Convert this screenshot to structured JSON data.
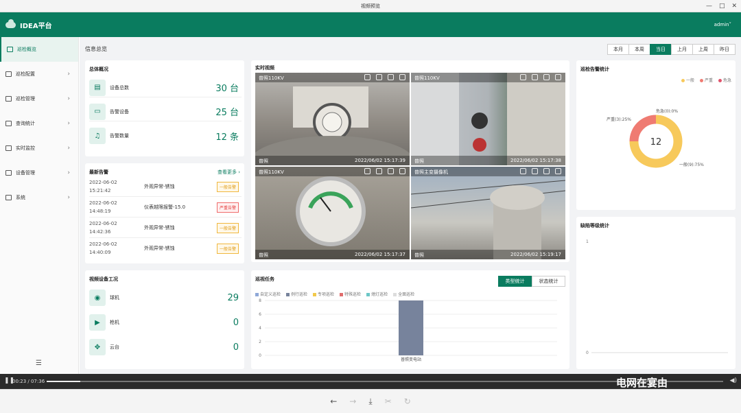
{
  "window": {
    "title": "视频预览"
  },
  "header": {
    "app_name": "IDEA平台",
    "user": "admin"
  },
  "sidebar": {
    "items": [
      {
        "label": "巡检概览",
        "active": true,
        "chevron": ""
      },
      {
        "label": "巡检配置",
        "chevron": "›"
      },
      {
        "label": "巡检管理",
        "chevron": "›"
      },
      {
        "label": "查询统计",
        "chevron": "›"
      },
      {
        "label": "实时监控",
        "chevron": "›"
      },
      {
        "label": "设备管理",
        "chevron": "›"
      },
      {
        "label": "系统",
        "chevron": "›"
      }
    ]
  },
  "main": {
    "page_title": "信息总览",
    "time_buttons": [
      "本月",
      "本周",
      "当日",
      "上月",
      "上周",
      "昨日"
    ],
    "active_time": "当日"
  },
  "overview": {
    "title": "总体概况",
    "rows": [
      {
        "label": "设备总数",
        "value": "30 台"
      },
      {
        "label": "告警设备",
        "value": "25 台"
      },
      {
        "label": "告警数量",
        "value": "12 条"
      }
    ]
  },
  "alarms": {
    "title": "最新告警",
    "more": "查看更多 ›",
    "rows": [
      {
        "date": "2022-06-02",
        "time": "15:21:42",
        "desc": "外观异常-锈蚀",
        "tag": "一般告警",
        "level": "normal"
      },
      {
        "date": "2022-06-02",
        "time": "14:48:19",
        "desc": "仪表越限报警-15.0",
        "tag": "严重告警",
        "level": "serious"
      },
      {
        "date": "2022-06-02",
        "time": "14:42:36",
        "desc": "外观异常-锈蚀",
        "tag": "一般告警",
        "level": "normal"
      },
      {
        "date": "2022-06-02",
        "time": "14:40:09",
        "desc": "外观异常-锈蚀",
        "tag": "一般告警",
        "level": "normal"
      }
    ]
  },
  "video_devices": {
    "title": "视频设备工况",
    "rows": [
      {
        "label": "球机",
        "value": "29"
      },
      {
        "label": "枪机",
        "value": "0"
      },
      {
        "label": "云台",
        "value": "0"
      }
    ]
  },
  "live": {
    "title": "实时视频",
    "cells": [
      {
        "name": "普照110KV",
        "caption": "普照",
        "ts": "2022/06/02 15:17:39"
      },
      {
        "name": "普照110KV",
        "caption": "普照",
        "ts": "2022/06/02 15:17:38"
      },
      {
        "name": "普照110KV",
        "caption": "普照",
        "ts": "2022/06/02 15:17:37"
      },
      {
        "name": "普照主变摄像机",
        "caption": "普照",
        "ts": "2022/06/02 15:19:17"
      }
    ]
  },
  "tasks": {
    "title": "巡视任务",
    "tabs": [
      "类型统计",
      "状态统计"
    ],
    "active_tab": "类型统计",
    "legend": [
      {
        "name": "自定义巡检",
        "color": "#8fa8d8"
      },
      {
        "name": "例行巡检",
        "color": "#77839c"
      },
      {
        "name": "专项巡检",
        "color": "#f2c94c"
      },
      {
        "name": "特殊巡检",
        "color": "#e06c6c"
      },
      {
        "name": "熄灯巡检",
        "color": "#6cc7c7"
      },
      {
        "name": "全面巡检",
        "color": "#dddddd"
      }
    ]
  },
  "chart_data": [
    {
      "type": "bar",
      "title": "巡视任务",
      "categories": [
        "普照变电站"
      ],
      "series": [
        {
          "name": "例行巡检",
          "values": [
            8
          ]
        }
      ],
      "yticks": [
        "0",
        "2",
        "4",
        "6",
        "8"
      ],
      "ylim": [
        0,
        8
      ]
    },
    {
      "type": "pie",
      "title": "巡检告警统计",
      "center_label": "12",
      "legend": [
        "一般",
        "严重",
        "危急"
      ],
      "slices": [
        {
          "name": "一般",
          "value": 9,
          "label": "一般(9):75%",
          "color": "#f7c95b"
        },
        {
          "name": "严重",
          "value": 3,
          "label": "严重(3):25%",
          "color": "#ef7b72"
        },
        {
          "name": "危急",
          "value": 0,
          "label": "危急(0):0%",
          "color": "#e0536b"
        }
      ]
    },
    {
      "type": "bar",
      "title": "缺陷等级统计",
      "categories": [],
      "series": [],
      "yticks": [
        "0",
        "1"
      ],
      "ylim": [
        0,
        1
      ]
    }
  ],
  "defects": {
    "title": "缺陷等级统计"
  },
  "player": {
    "time": "00:23 / 07:36",
    "progress": 0.05,
    "watermark": "电网在宴由"
  }
}
